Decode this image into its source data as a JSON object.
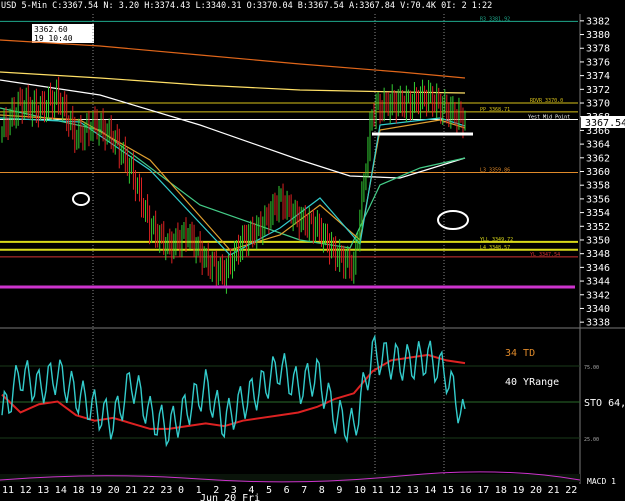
{
  "header": {
    "text": "USD 5-Min C:3367.54 N: 3.20 H:3374.43 L:3340.31 O:3370.04 B:3367.54 A:3367.84 V:70.4K 0I: 2 1:22",
    "tooltip_value": "3362.60",
    "tooltip_time": "19 10:40"
  },
  "price_axis": {
    "min": 3337,
    "max": 3383,
    "ticks": [
      3382,
      3380,
      3378,
      3376,
      3374,
      3372,
      3370,
      3368,
      3366,
      3364,
      3362,
      3360,
      3358,
      3356,
      3354,
      3352,
      3350,
      3348,
      3346,
      3344,
      3342,
      3340,
      3338
    ],
    "last_price": "3367.54"
  },
  "time_axis": {
    "labels": [
      "11",
      "12",
      "13",
      "14",
      "18",
      "19",
      "20",
      "21",
      "22",
      "23",
      "0",
      "1",
      "2",
      "3",
      "4",
      "5",
      "6",
      "7",
      "8",
      "9",
      "10",
      "11",
      "12",
      "13",
      "14",
      "15",
      "16",
      "17",
      "18",
      "19",
      "20",
      "21",
      "22"
    ],
    "date_label": "Jun 20 Fri"
  },
  "levels": [
    {
      "label": "R3 3381.92",
      "price": 3381.92,
      "color": "#1fa88c"
    },
    {
      "label": "PP 3368.71",
      "price": 3368.71,
      "color": "#d9c21a"
    },
    {
      "label": "RDVR 3370.0",
      "price": 3370.0,
      "color": "#d9c21a"
    },
    {
      "label": "Yest Mid Point",
      "price": 3367.6,
      "color": "#ffffff"
    },
    {
      "label": "L3 3359.86",
      "price": 3359.86,
      "color": "#e08a2a"
    },
    {
      "label": "YLL 3349.72",
      "price": 3349.72,
      "color": "#d9d91a"
    },
    {
      "label": "L4 3348.57",
      "price": 3348.57,
      "color": "#d9d91a"
    },
    {
      "label": "YL 3347.54",
      "price": 3347.54,
      "color": "#d23333"
    }
  ],
  "indicator": {
    "td_label": "34 TD",
    "yrange_label": "40 YRange",
    "sto_label": "STO 64,",
    "macd_label": "MACD 1",
    "level_75": "75.00",
    "level_25": "25.00"
  },
  "colors": {
    "up_candle": "#33cc33",
    "down_candle": "#dd2222",
    "stoch": "#33cccc",
    "td_line": "#dd2222",
    "magenta": "#cc33cc"
  },
  "chart_data": {
    "type": "line",
    "title": "USD 5-Min",
    "x": [
      "11",
      "12",
      "13",
      "14",
      "18",
      "19",
      "20",
      "21",
      "22",
      "23",
      "0",
      "1",
      "2",
      "3",
      "4",
      "5",
      "6",
      "7",
      "8",
      "9",
      "10",
      "11",
      "12",
      "13",
      "14",
      "15"
    ],
    "series": [
      {
        "name": "Close",
        "values": [
          3366,
          3370,
          3369,
          3371,
          3365,
          3367,
          3365,
          3360,
          3352,
          3349,
          3351,
          3347,
          3345,
          3350,
          3352,
          3356,
          3353,
          3352,
          3348,
          3346,
          3369,
          3370,
          3370,
          3371,
          3369,
          3367.54
        ]
      },
      {
        "name": "34 TD",
        "values": [
          55,
          42,
          48,
          50,
          40,
          36,
          38,
          34,
          30,
          30,
          32,
          34,
          32,
          36,
          38,
          40,
          42,
          46,
          52,
          56,
          72,
          80,
          82,
          84,
          80,
          78
        ]
      },
      {
        "name": "STO",
        "values": [
          40,
          70,
          60,
          70,
          55,
          45,
          35,
          65,
          40,
          30,
          45,
          60,
          35,
          50,
          60,
          75,
          60,
          70,
          40,
          30,
          85,
          80,
          78,
          82,
          70,
          35
        ]
      }
    ],
    "ylim": [
      3337,
      3383
    ],
    "xlabel": "",
    "ylabel": ""
  }
}
